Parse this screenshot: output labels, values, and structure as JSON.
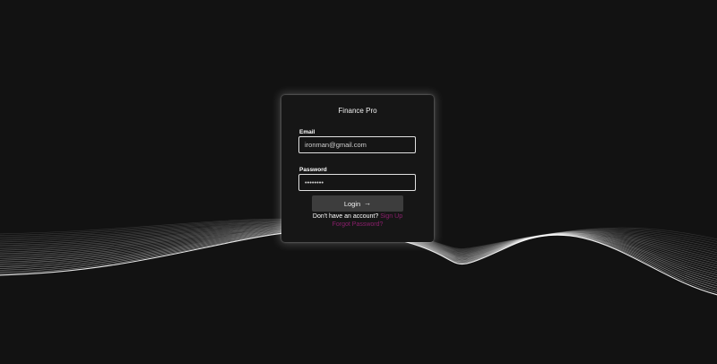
{
  "login_card": {
    "brand_title": "Finance Pro",
    "email_label": "Email",
    "email_value": "ironman@gmail.com",
    "password_label": "Password",
    "password_value": "ironman1",
    "login_label": "Login",
    "login_icon": "arrow-right-icon",
    "signup_prompt": "Don't have an account?",
    "signup_link": "Sign Up",
    "forgot_link": "Forgot Password?"
  },
  "colors": {
    "background": "#121212",
    "card": "#161616",
    "button": "#3d3d3d",
    "link": "#8a1f6b",
    "wave": "#ffffff"
  }
}
